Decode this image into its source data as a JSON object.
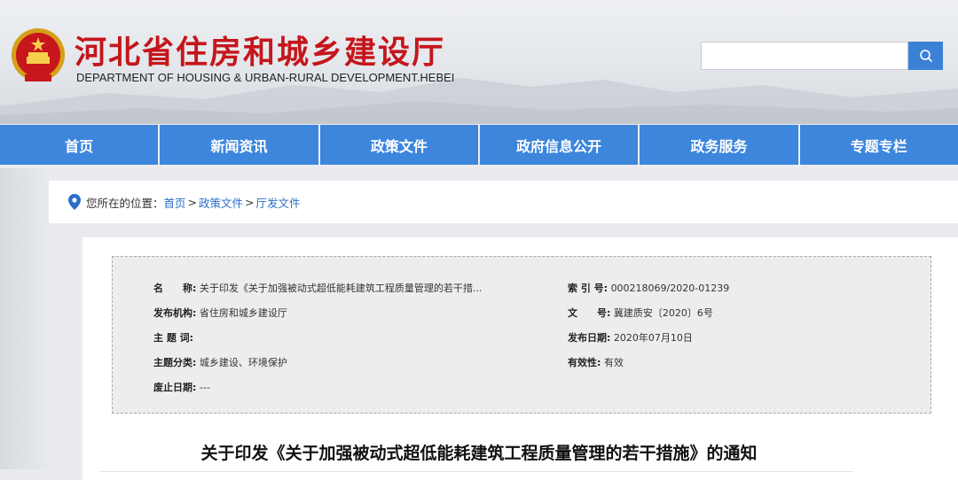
{
  "header": {
    "title": "河北省住房和城乡建设厅",
    "subtitle": "DEPARTMENT OF HOUSING & URBAN-RURAL DEVELOPMENT.HEBEI",
    "search": {
      "value": "",
      "placeholder": ""
    },
    "colors": {
      "title": "#c4161c",
      "accent": "#3d86dc"
    }
  },
  "nav": {
    "items": [
      "首页",
      "新闻资讯",
      "政策文件",
      "政府信息公开",
      "政务服务",
      "专题专栏"
    ]
  },
  "breadcrumb": {
    "prefix": "您所在的位置：",
    "items": [
      "首页",
      "政策文件",
      "厅发文件"
    ],
    "separator": ">"
  },
  "meta": {
    "name_label": "名　　称:",
    "name_value": "关于印发《关于加强被动式超低能耗建筑工程质量管理的若干措...",
    "index_label": "索 引 号:",
    "index_value": "000218069/2020-01239",
    "org_label": "发布机构:",
    "org_value": "省住房和城乡建设厅",
    "docno_label": "文　　号:",
    "docno_value": "冀建质安〔2020〕6号",
    "keywords_label": "主 题 词:",
    "keywords_value": "",
    "date_label": "发布日期:",
    "date_value": "2020年07月10日",
    "category_label": "主题分类:",
    "category_value": "城乡建设、环境保护",
    "validity_label": "有效性:",
    "validity_value": "有效",
    "expire_label": "废止日期:",
    "expire_value": "---"
  },
  "document": {
    "title": "关于印发《关于加强被动式超低能耗建筑工程质量管理的若干措施》的通知"
  }
}
